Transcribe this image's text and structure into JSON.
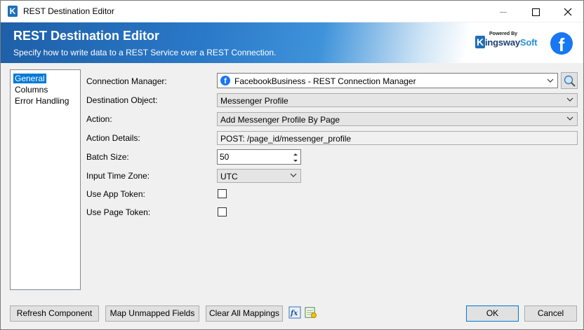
{
  "window": {
    "title": "REST Destination Editor",
    "icon": "kingswaysoft-k-icon",
    "controls": [
      "minimize-icon",
      "maximize-icon",
      "close-icon"
    ]
  },
  "banner": {
    "title": "REST Destination Editor",
    "subtitle": "Specify how to write data to a REST Service over a REST Connection.",
    "logo": {
      "powered_by": "Powered By",
      "brand_k": "K",
      "brand_ingsway": "ingsway",
      "brand_soft": "Soft"
    },
    "service_icon": "facebook-icon"
  },
  "nav": {
    "items": [
      {
        "label": "General",
        "selected": true
      },
      {
        "label": "Columns",
        "selected": false
      },
      {
        "label": "Error Handling",
        "selected": false
      }
    ]
  },
  "form": {
    "connection_manager": {
      "label": "Connection Manager:",
      "value": "FacebookBusiness - REST Connection Manager"
    },
    "destination_object": {
      "label": "Destination Object:",
      "value": "Messenger Profile"
    },
    "action": {
      "label": "Action:",
      "value": "Add Messenger Profile By Page"
    },
    "action_details": {
      "label": "Action Details:",
      "value": "POST: /page_id/messenger_profile"
    },
    "batch_size": {
      "label": "Batch Size:",
      "value": "50"
    },
    "input_time_zone": {
      "label": "Input Time Zone:",
      "value": "UTC"
    },
    "use_app_token": {
      "label": "Use App Token:",
      "checked": false
    },
    "use_page_token": {
      "label": "Use Page Token:",
      "checked": false
    }
  },
  "footer": {
    "refresh": "Refresh Component",
    "map_unmapped": "Map Unmapped Fields",
    "clear_mappings": "Clear All Mappings",
    "expression_icon": "fx-expression-icon",
    "variables_icon": "variables-icon",
    "ok": "OK",
    "cancel": "Cancel"
  },
  "colors": {
    "accent": "#0078d7",
    "banner_blue": "#1e5fa8",
    "facebook_blue": "#1877f2"
  }
}
